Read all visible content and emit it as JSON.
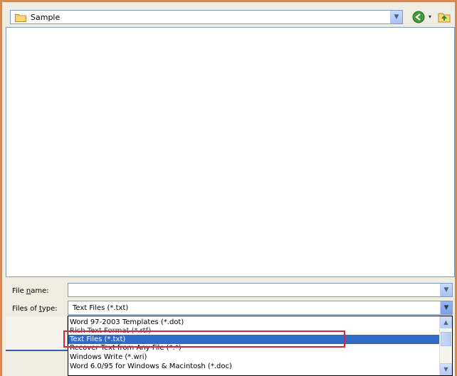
{
  "look_in": {
    "value": "Sample"
  },
  "file_name": {
    "label_pre": "File ",
    "label_u": "n",
    "label_post": "ame:",
    "value": ""
  },
  "file_type": {
    "label_pre": "Files of ",
    "label_u": "t",
    "label_post": "ype:",
    "value": "Text Files (*.txt)",
    "options": [
      "Word 97-2003 Templates (*.dot)",
      "Rich Text Format (*.rtf)",
      "Text Files (*.txt)",
      "Recover Text from Any File (*.*)",
      "Windows Write (*.wri)",
      "Word 6.0/95 for Windows & Macintosh (*.doc)"
    ],
    "selected_index": 2
  },
  "icons": {
    "folder": "folder-icon",
    "back": "back-icon",
    "up": "up-folder-icon",
    "dropdown": "chevron-down-icon"
  },
  "colors": {
    "selection": "#316ac5",
    "highlight_box": "#d8253a",
    "frame": "#d08a58"
  }
}
